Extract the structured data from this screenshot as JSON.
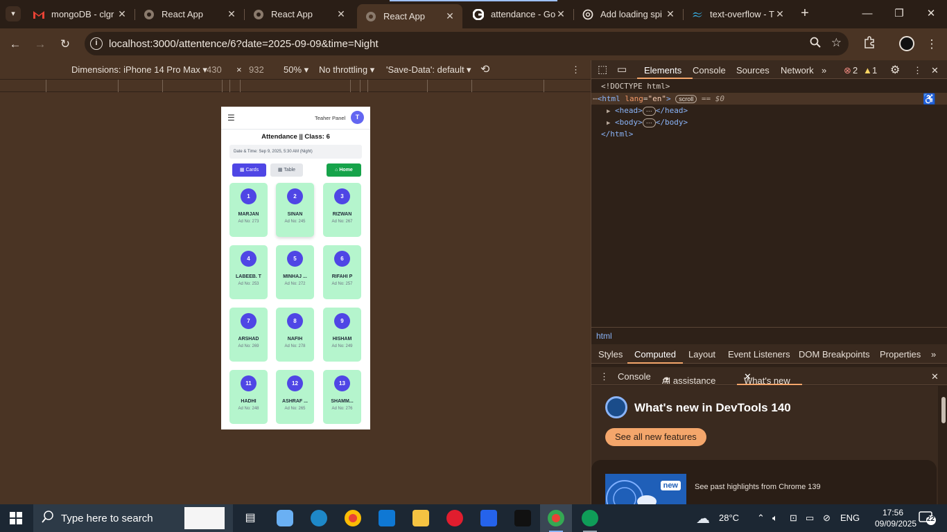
{
  "browser": {
    "tabs": [
      {
        "title": "mongoDB - clgr",
        "icon": "gmail-icon"
      },
      {
        "title": "React App",
        "icon": "globe-icon"
      },
      {
        "title": "React App",
        "icon": "globe-icon"
      },
      {
        "title": "React App",
        "icon": "globe-icon"
      },
      {
        "title": "attendance - Go",
        "icon": "google-icon"
      },
      {
        "title": "Add loading spi",
        "icon": "openai-icon"
      },
      {
        "title": "text-overflow - T",
        "icon": "tailwind-icon"
      }
    ],
    "url": "localhost:3000/attentence/6?date=2025-09-09&time=Night"
  },
  "device_toolbar": {
    "dimensions": "Dimensions: iPhone 14 Pro Max",
    "width": "430",
    "height": "932",
    "zoom": "50%",
    "throttling": "No throttling",
    "save_data": "'Save-Data': default"
  },
  "app": {
    "panel_label": "Teaher Panel",
    "avatar_letter": "T",
    "title": "Attendance || Class: 6",
    "datetime": "Date & Time: Sep 9, 2025, 5:30 AM (Night)",
    "btn_cards": "Cards",
    "btn_table": "Table",
    "btn_home": "Home",
    "students": [
      {
        "num": "1",
        "name": "MARJAN",
        "adno": "Ad No: 273"
      },
      {
        "num": "2",
        "name": "SINAN",
        "adno": "Ad No: 245"
      },
      {
        "num": "3",
        "name": "RIZWAN",
        "adno": "Ad No: 267"
      },
      {
        "num": "4",
        "name": "LABEEB. T",
        "adno": "Ad No: 253"
      },
      {
        "num": "5",
        "name": "MINHAJ ...",
        "adno": "Ad No: 272"
      },
      {
        "num": "6",
        "name": "RIFAHI P",
        "adno": "Ad No: 257"
      },
      {
        "num": "7",
        "name": "ARSHAD",
        "adno": "Ad No: 269"
      },
      {
        "num": "8",
        "name": "NAFIH",
        "adno": "Ad No: 278"
      },
      {
        "num": "9",
        "name": "HISHAM",
        "adno": "Ad No: 249"
      },
      {
        "num": "11",
        "name": "HADHI",
        "adno": "Ad No: 248"
      },
      {
        "num": "12",
        "name": "ASHRAF ...",
        "adno": "Ad No: 265"
      },
      {
        "num": "13",
        "name": "SHAMM...",
        "adno": "Ad No: 276"
      }
    ]
  },
  "devtools": {
    "tabs": [
      "Elements",
      "Console",
      "Sources",
      "Network"
    ],
    "errors": "2",
    "warnings": "1",
    "dom": {
      "doctype": "<!DOCTYPE html>",
      "html_open": "<html",
      "attr_name": "lang",
      "attr_value": "\"en\"",
      "scroll_pill": "scroll",
      "eq": "== $0",
      "head": "<head>",
      "head_close": "</head>",
      "body": "<body>",
      "body_close": "</body>",
      "html_close": "</html>"
    },
    "breadcrumb": "html",
    "sub_tabs": [
      "Styles",
      "Computed",
      "Layout",
      "Event Listeners",
      "DOM Breakpoints",
      "Properties"
    ],
    "drawer_tabs": [
      "Console",
      "AI assistance",
      "What's new"
    ],
    "whats_new_title": "What's new in DevTools 140",
    "see_all": "See all new features",
    "new_badge": "new",
    "past_highlights": "See past highlights from Chrome 139"
  },
  "taskbar": {
    "search_placeholder": "Type here to search",
    "weather": "28°C",
    "lang": "ENG",
    "time": "17:56",
    "date": "09/09/2025",
    "notifications": "22"
  },
  "colors": {
    "accent": "#4f46e5",
    "card_bg": "#b5f5cd",
    "home_green": "#16a34a",
    "devtools_accent": "#f4a66b"
  }
}
